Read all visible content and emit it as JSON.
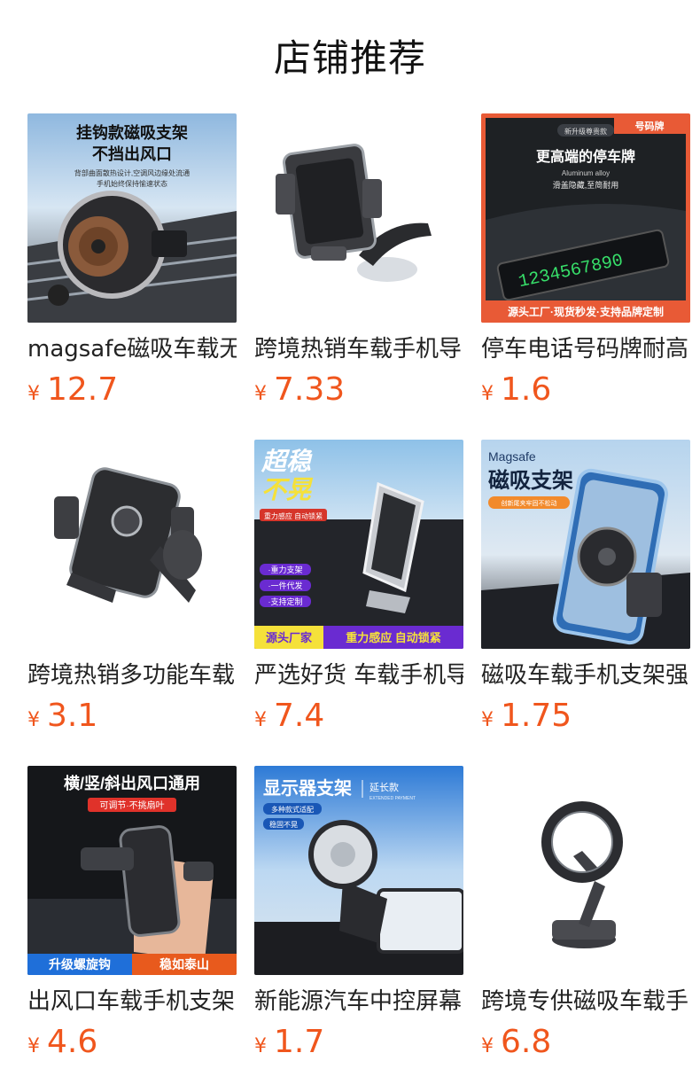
{
  "header": {
    "title": "店铺推荐"
  },
  "currency_symbol": "¥",
  "products": [
    {
      "name": "magsafe磁吸车载无",
      "price": "12.7",
      "image_text": [
        "挂钩款磁吸支架",
        "不挡出风口",
        "背部曲面散热设计,空调风边缘处流通",
        "手机始终保持愉速状态"
      ],
      "image_kind": "magsafe-vent-mount-photo"
    },
    {
      "name": "跨境热销车载手机导",
      "price": "7.33",
      "image_text": [],
      "image_kind": "suction-phone-holder-photo"
    },
    {
      "name": "停车电话号码牌耐高",
      "price": "1.6",
      "image_text": [
        "号码牌",
        "新升级尊贵款",
        "更高端的停车牌",
        "Aluminum alloy",
        "滑盖隐藏,至简耐用",
        "1234567890",
        "源头工厂·现货秒发·支持品牌定制"
      ],
      "image_kind": "parking-number-plate-photo"
    },
    {
      "name": "跨境热销多功能车载",
      "price": "3.1",
      "image_text": [],
      "image_kind": "vent-clip-holder-photo"
    },
    {
      "name": "严选好货 车载手机导",
      "price": "7.4",
      "image_text": [
        "超稳",
        "不晃",
        "重力感应 自动锁紧",
        "·重力支架",
        "·一件代发",
        "·支持定制",
        "源头厂家",
        "重力感应 自动锁紧"
      ],
      "image_kind": "gravity-holder-photo"
    },
    {
      "name": "磁吸车载手机支架强",
      "price": "1.75",
      "image_text": [
        "Magsafe",
        "磁吸支架",
        "创新尾夹牢固不松动"
      ],
      "image_kind": "magnetic-holder-with-phone-photo"
    },
    {
      "name": "出风口车载手机支架",
      "price": "4.6",
      "image_text": [
        "横/竖/斜出风口通用",
        "可调节·不挑扇叶",
        "升级螺旋钩",
        "稳如泰山"
      ],
      "image_kind": "vent-holder-in-hand-photo"
    },
    {
      "name": "新能源汽车中控屏幕",
      "price": "1.7",
      "image_text": [
        "显示器支架",
        "延长款",
        "EXTENDED PAYMENT",
        "多种款式适配",
        "稳固不晃"
      ],
      "image_kind": "screen-mount-photo"
    },
    {
      "name": "跨境专供磁吸车载手",
      "price": "6.8",
      "image_text": [],
      "image_kind": "folding-magnetic-ring-stand-photo"
    }
  ]
}
